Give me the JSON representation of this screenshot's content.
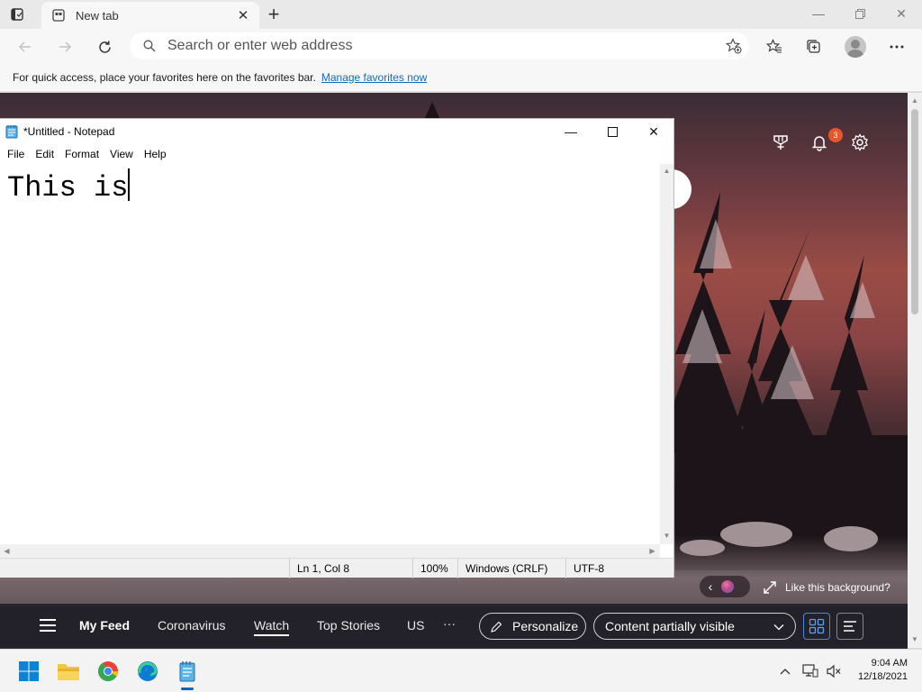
{
  "browser": {
    "tab": {
      "title": "New tab"
    },
    "address": {
      "placeholder": "Search or enter web address"
    },
    "favorites_bar": {
      "message": "For quick access, place your favorites here on the favorites bar.",
      "link": "Manage favorites now"
    }
  },
  "newtab_page": {
    "notification_count": "3",
    "like_background": "Like this background?",
    "feed": {
      "items": [
        "My Feed",
        "Coronavirus",
        "Watch",
        "Top Stories",
        "US"
      ],
      "more": "···",
      "personalize": "Personalize",
      "content_visibility": "Content partially visible"
    }
  },
  "notepad": {
    "title": "*Untitled - Notepad",
    "menu": [
      "File",
      "Edit",
      "Format",
      "View",
      "Help"
    ],
    "content": "This is",
    "status": {
      "position": "Ln 1, Col 8",
      "zoom": "100%",
      "line_endings": "Windows (CRLF)",
      "encoding": "UTF-8"
    }
  },
  "taskbar": {
    "apps": [
      "start-icon",
      "file-explorer-icon",
      "chrome-icon",
      "edge-icon",
      "notepad-icon"
    ],
    "clock": {
      "time": "9:04 AM",
      "date": "12/18/2021"
    }
  },
  "colors": {
    "accent": "#0067c0",
    "link": "#0f6cbd",
    "badge": "#e8562a"
  }
}
